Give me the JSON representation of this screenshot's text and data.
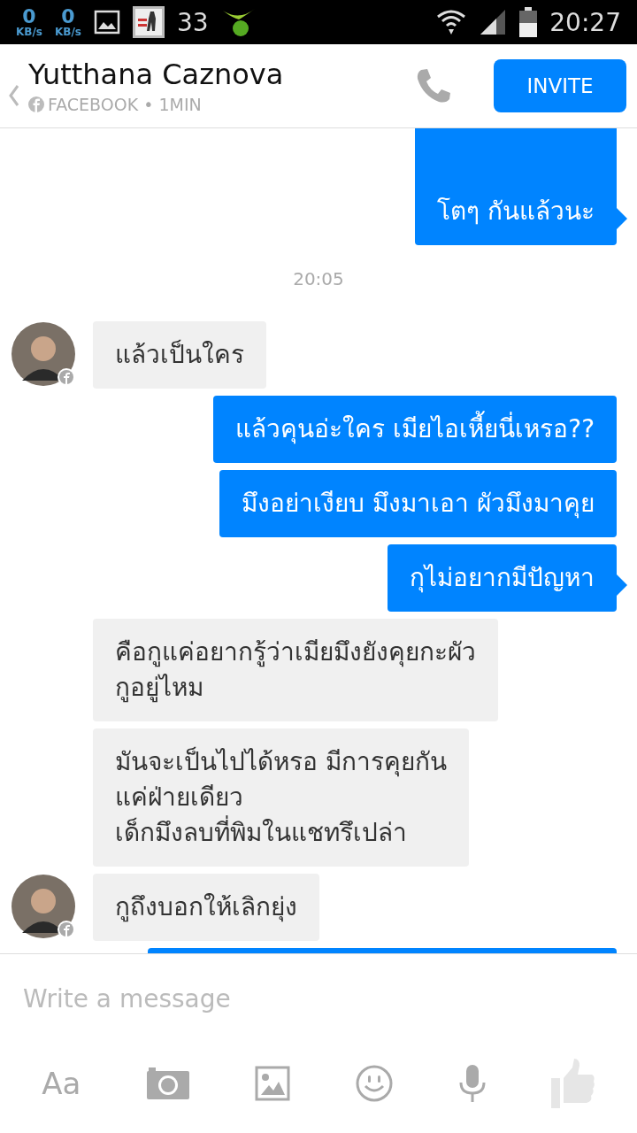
{
  "status_bar": {
    "net_down": {
      "value": "0",
      "unit": "KB/s"
    },
    "net_up": {
      "value": "0",
      "unit": "KB/s"
    },
    "notification_count": "33",
    "time": "20:27"
  },
  "header": {
    "name": "Yutthana Caznova",
    "source": "FACEBOOK • 1MIN",
    "invite": "INVITE"
  },
  "messages": [
    {
      "kind": "out",
      "text": "โตๆ กันแล้วนะ",
      "tail": true
    },
    {
      "kind": "time",
      "text": "20:05"
    },
    {
      "kind": "in",
      "text": "แล้วเป็นใคร",
      "avatar": true
    },
    {
      "kind": "out",
      "text": "แล้วคุนอ่ะใคร เมียไอเหี้ยนี่เหรอ??",
      "tail": false
    },
    {
      "kind": "out",
      "text": "มึงอย่าเงียบ มึงมาเอา ผัวมึงมาคุย",
      "tail": false
    },
    {
      "kind": "out",
      "text": "กุไม่อยากมีปัญหา",
      "tail": true
    },
    {
      "kind": "in",
      "text": "คือกูแค่อยากรู้ว่าเมียมึงยังคุยกะผัว\nกูอยู่ไหม",
      "avatar": false
    },
    {
      "kind": "in",
      "text": "มันจะเป็นไปได้หรอ มีการคุยกัน\nแค่ฝ่ายเดียว\nเด็กมึงลบที่พิมในแชทรึเปล่า",
      "avatar": false
    },
    {
      "kind": "in",
      "text": "กูถึงบอกให้เลิกยุ่ง",
      "avatar": true
    },
    {
      "kind": "out",
      "tail": false
    }
  ],
  "composer": {
    "placeholder": "Write a message",
    "text_button": "Aa"
  }
}
